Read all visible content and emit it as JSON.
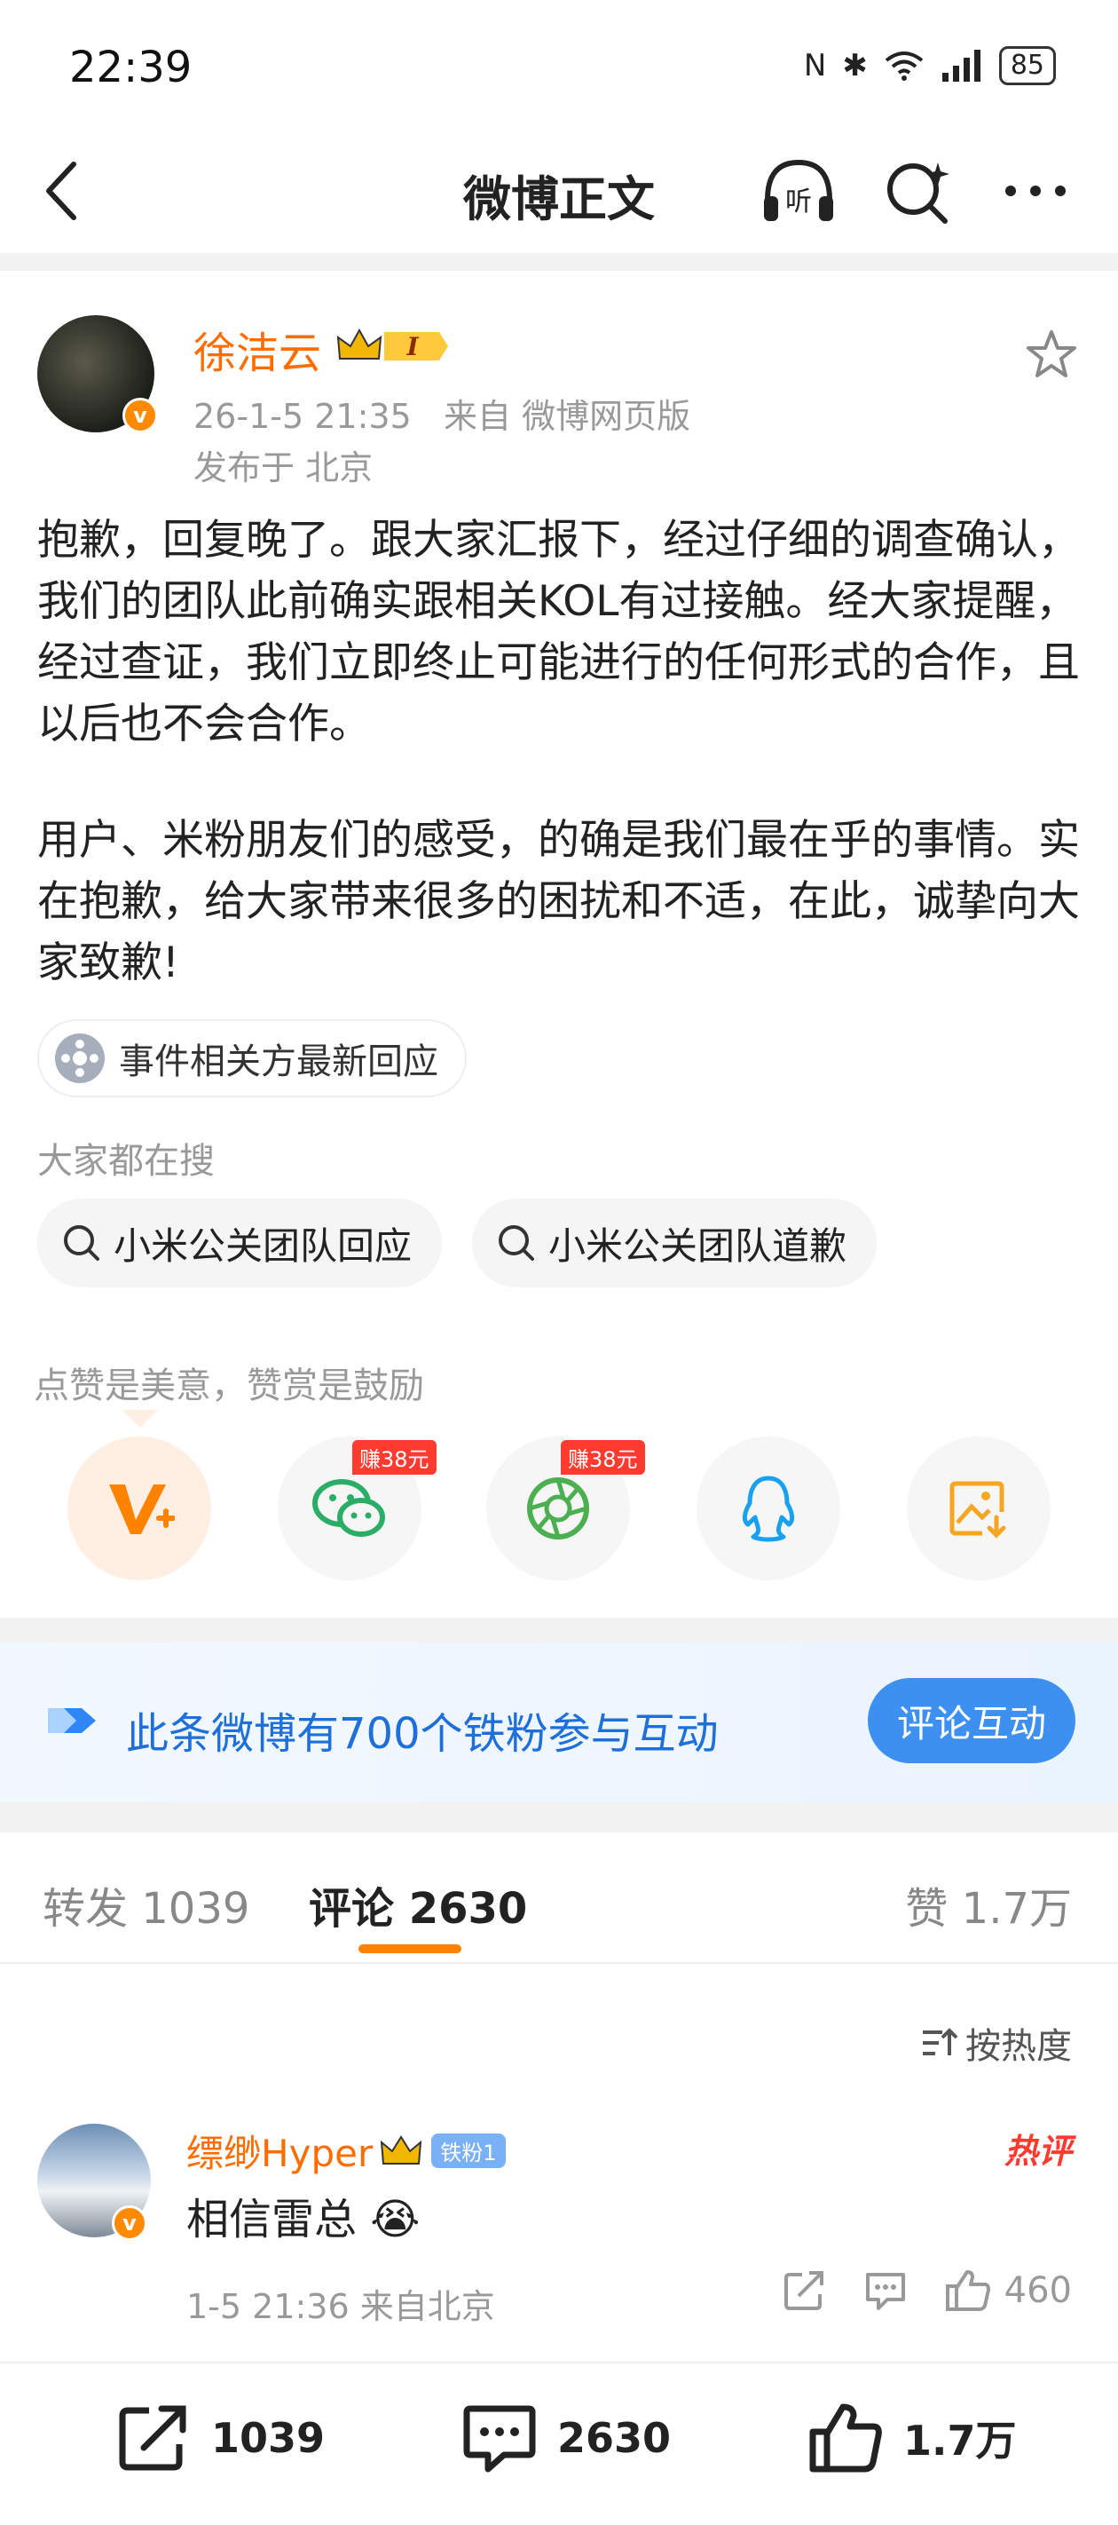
{
  "status_bar": {
    "time": "22:39",
    "battery": "85"
  },
  "nav": {
    "title": "微博正文"
  },
  "post": {
    "author": "徐洁云",
    "level_badge": "I",
    "time": "26-1-5 21:35",
    "source": "来自 微博网页版",
    "location": "发布于 北京",
    "paragraphs": [
      "抱歉，回复晚了。跟大家汇报下，经过仔细的调查确认，我们的团队此前确实跟相关KOL有过接触。经大家提醒，经过查证，我们立即终止可能进行的任何形式的合作，且以后也不会合作。",
      "用户、米粉朋友们的感受，的确是我们最在乎的事情。实在抱歉，给大家带来很多的困扰和不适，在此，诚挚向大家致歉!"
    ],
    "topic_chip": "事件相关方最新回应"
  },
  "searches": {
    "label": "大家都在搜",
    "items": [
      "小米公关团队回应",
      "小米公关团队道歉"
    ]
  },
  "tips": {
    "label": "点赞是美意，赞赏是鼓励",
    "earn_tag": "赚38元"
  },
  "fan_banner": {
    "text": "此条微博有700个铁粉参与互动",
    "button": "评论互动"
  },
  "tabs": {
    "repost": "转发 1039",
    "comment": "评论 2630",
    "like": "赞 1.7万"
  },
  "sort_label": "按热度",
  "comment": {
    "user": "缥缈Hyper",
    "fan_badge": "铁粉1",
    "hot_label": "热评",
    "text": "相信雷总",
    "meta": "1-5 21:36 来自北京",
    "likes": "460"
  },
  "bottom": {
    "reposts": "1039",
    "comments": "2630",
    "likes": "1.7万"
  },
  "colors": {
    "accent": "#ff8200",
    "author": "#ff6d00",
    "link": "#1e6fd9"
  }
}
